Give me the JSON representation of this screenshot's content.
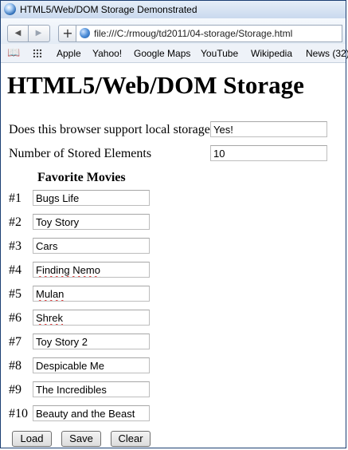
{
  "window": {
    "title": "HTML5/Web/DOM Storage Demonstrated"
  },
  "browser": {
    "back_icon": "◀",
    "forward_icon": "▶",
    "new_tab_icon": "+",
    "url": "file:///C:/rmoug/td2011/04-storage/Storage.html",
    "bookmarks": [
      "Apple",
      "Yahoo!",
      "Google Maps",
      "YouTube",
      "Wikipedia",
      "News (32)"
    ]
  },
  "page": {
    "heading": "HTML5/Web/DOM Storage",
    "support_label": "Does this browser support local storage?",
    "support_value": "Yes!",
    "count_label": "Number of Stored Elements",
    "count_value": "10",
    "movies_heading": "Favorite Movies",
    "movies": [
      {
        "num": "#1",
        "title": "Bugs Life"
      },
      {
        "num": "#2",
        "title": "Toy Story"
      },
      {
        "num": "#3",
        "title": "Cars"
      },
      {
        "num": "#4",
        "title": "Finding Nemo"
      },
      {
        "num": "#5",
        "title": "Mulan"
      },
      {
        "num": "#6",
        "title": "Shrek"
      },
      {
        "num": "#7",
        "title": "Toy Story 2"
      },
      {
        "num": "#8",
        "title": "Despicable Me"
      },
      {
        "num": "#9",
        "title": "The Incredibles"
      },
      {
        "num": "#10",
        "title": "Beauty and the Beast"
      }
    ],
    "buttons": {
      "load": "Load",
      "save": "Save",
      "clear": "Clear"
    }
  }
}
